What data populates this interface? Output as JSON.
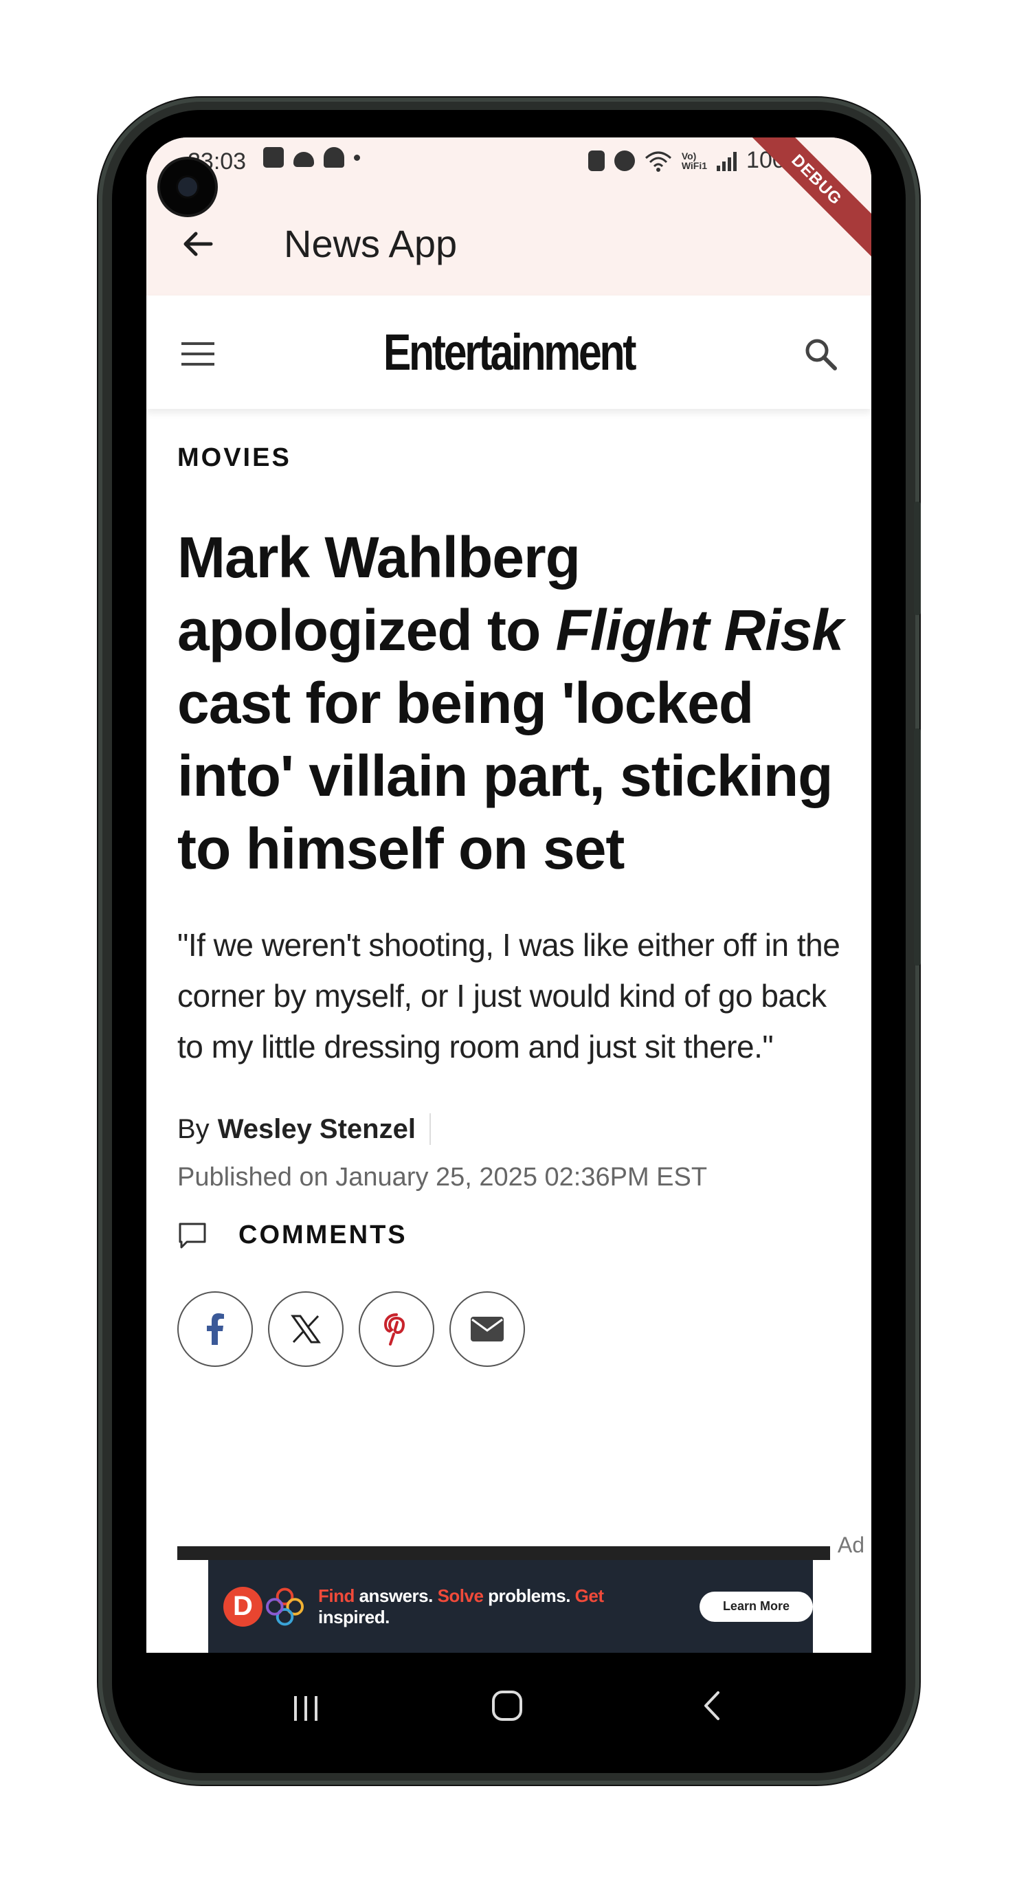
{
  "status_bar": {
    "time": "23:03",
    "battery": "100%",
    "volte_top": "Vo)",
    "volte_bottom": "WiFi1"
  },
  "debug_banner": "DEBUG",
  "app_bar": {
    "title": "News App"
  },
  "site_header": {
    "logo": "Entertainment"
  },
  "article": {
    "category": "MOVIES",
    "headline_part1": "Mark Wahlberg apologized to ",
    "headline_italic1": "Flight Risk",
    "headline_part2": " cast for being 'locked into' villain part, sticking to himself on set",
    "dek": "\"If we weren't shooting, I was like either off in the corner by myself, or I just would kind of go back to my little dressing room and just sit there.\"",
    "byline_prefix": "By",
    "author": "Wesley Stenzel",
    "published": "Published on January 25, 2025 02:36PM EST",
    "comments_label": "COMMENTS"
  },
  "share": {
    "icons": [
      "facebook-icon",
      "x-icon",
      "pinterest-icon",
      "email-icon"
    ]
  },
  "ad": {
    "label": "Ad",
    "logo_letter": "D",
    "text_find": "Find",
    "text_answers": " answers. ",
    "text_solve": "Solve",
    "text_problems": " problems. ",
    "text_get": "Get",
    "text_inspired": " inspired.",
    "cta": "Learn More"
  },
  "colors": {
    "app_bar_bg": "#fcf1ee",
    "debug_ribbon": "#a83a3a",
    "facebook_blue": "#3b5998",
    "pinterest_red": "#c8232c",
    "ad_bg": "#1f2733",
    "ad_accent": "#f04a3a"
  }
}
